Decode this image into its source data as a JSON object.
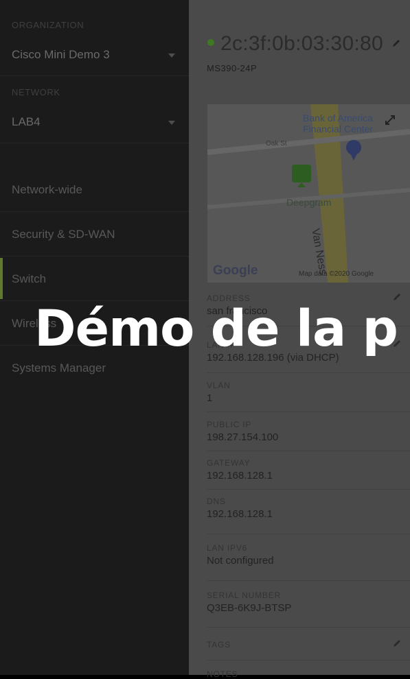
{
  "sidebar": {
    "organization_label": "ORGANIZATION",
    "organization_value": "Cisco Mini Demo 3",
    "network_label": "NETWORK",
    "network_value": "LAB4",
    "nav_items": [
      {
        "label": "Network-wide"
      },
      {
        "label": "Security & SD-WAN"
      },
      {
        "label": "Switch"
      },
      {
        "label": "Wireless"
      },
      {
        "label": "Systems Manager"
      }
    ]
  },
  "device": {
    "name": "2c:3f:0b:03:30:80",
    "model": "MS390-24P",
    "status_color": "#3e7a22"
  },
  "map": {
    "poi": "Bank of America Financial Center",
    "street_oak": "Oak St",
    "street_van_ness": "Van Ness",
    "place": "Deepgram",
    "attribution": "Map data ©2020 Google",
    "logo": "Google"
  },
  "details": [
    {
      "label": "ADDRESS",
      "value": "san francisco"
    },
    {
      "label": "LAN IP",
      "value": "192.168.128.196 (via DHCP)"
    },
    {
      "label": "VLAN",
      "value": "1"
    },
    {
      "label": "PUBLIC IP",
      "value": "198.27.154.100"
    },
    {
      "label": "GATEWAY",
      "value": "192.168.128.1"
    },
    {
      "label": "DNS",
      "value": "192.168.128.1"
    },
    {
      "label": "LAN IPV6",
      "value": "Not configured"
    },
    {
      "label": "SERIAL NUMBER",
      "value": "Q3EB-6K9J-BTSP"
    },
    {
      "label": "TAGS",
      "value": ""
    },
    {
      "label": "NOTES",
      "value": ""
    }
  ],
  "overlay": {
    "title": "Démo de la p"
  }
}
